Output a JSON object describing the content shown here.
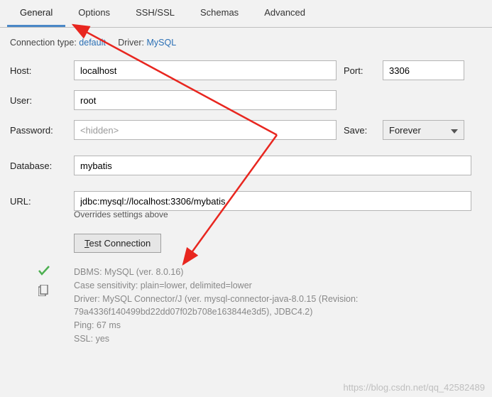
{
  "tabs": {
    "general": "General",
    "options": "Options",
    "sshssl": "SSH/SSL",
    "schemas": "Schemas",
    "advanced": "Advanced"
  },
  "conn": {
    "type_label": "Connection type:",
    "type_value": "default",
    "driver_label": "Driver:",
    "driver_value": "MySQL"
  },
  "labels": {
    "host": "Host:",
    "port": "Port:",
    "user": "User:",
    "password": "Password:",
    "save": "Save:",
    "database": "Database:",
    "url": "URL:"
  },
  "values": {
    "host": "localhost",
    "port": "3306",
    "user": "root",
    "password_placeholder": "<hidden>",
    "save_mode": "Forever",
    "database": "mybatis",
    "url": "jdbc:mysql://localhost:3306/mybatis"
  },
  "override_note": "Overrides settings above",
  "test_button": {
    "prefix": "T",
    "underline": "",
    "text": "est Connection"
  },
  "info": {
    "l1": "DBMS: MySQL (ver. 8.0.16)",
    "l2": "Case sensitivity: plain=lower, delimited=lower",
    "l3": "Driver: MySQL Connector/J (ver. mysql-connector-java-8.0.15 (Revision: 79a4336f140499bd22dd07f02b708e163844e3d5), JDBC4.2)",
    "l4": "Ping: 67 ms",
    "l5": "SSL: yes"
  },
  "watermark": "https://blog.csdn.net/qq_42582489"
}
